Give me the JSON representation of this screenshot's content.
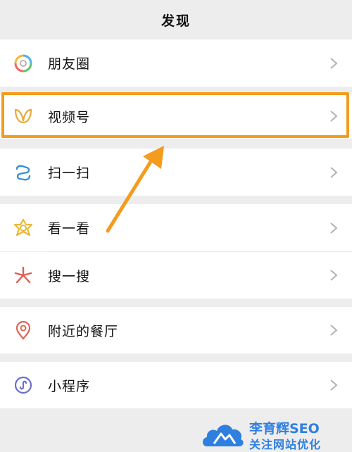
{
  "header": {
    "title": "发现"
  },
  "menu": {
    "moments": {
      "label": "朋友圈",
      "icon": "moments-aperture-icon"
    },
    "channels": {
      "label": "视频号",
      "icon": "channels-butterfly-icon"
    },
    "scan": {
      "label": "扫一扫",
      "icon": "scan-icon"
    },
    "top_stories": {
      "label": "看一看",
      "icon": "top-stories-icon"
    },
    "search": {
      "label": "搜一搜",
      "icon": "search-sparkle-icon"
    },
    "nearby": {
      "label": "附近的餐厅",
      "icon": "location-pin-icon"
    },
    "mini_programs": {
      "label": "小程序",
      "icon": "mini-program-icon"
    }
  },
  "annotation": {
    "highlight_color": "#f39c1d",
    "target": "视频号"
  },
  "watermark": {
    "line1": "李育辉SEO",
    "line2": "关注网站优化"
  }
}
